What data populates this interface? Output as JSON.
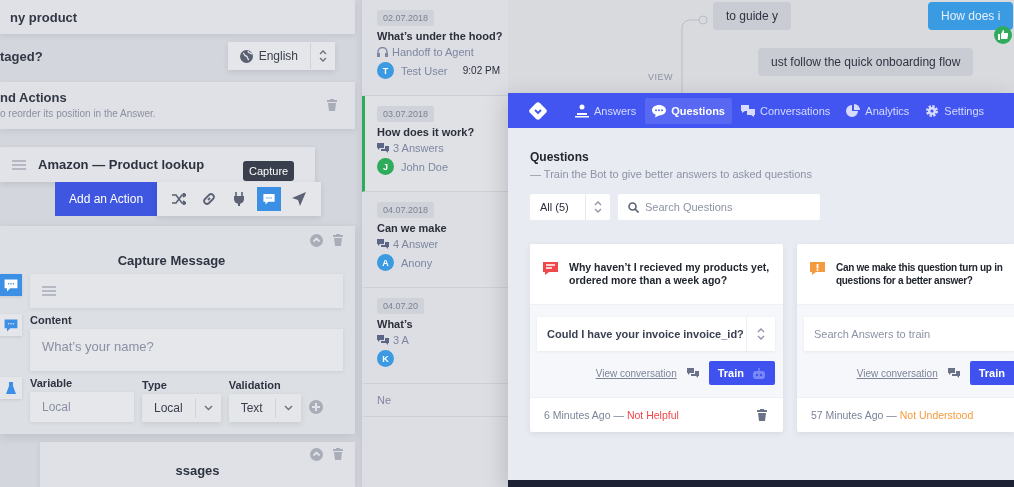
{
  "editor": {
    "heading_fragment": "ny product",
    "question_fragment": "taged?",
    "language": {
      "value": "English"
    },
    "actions": {
      "title": "nd Actions",
      "hint": "o reorder its position in the Answer."
    },
    "action": {
      "title": "Amazon — Product lookup"
    },
    "toolbar": {
      "button": "Add an Action",
      "tools": [
        {
          "kind": "shuffle",
          "selected": false
        },
        {
          "kind": "link",
          "selected": false
        },
        {
          "kind": "plug",
          "selected": false
        },
        {
          "kind": "chat",
          "selected": true,
          "tooltip": "Capture"
        },
        {
          "kind": "send",
          "selected": false
        }
      ]
    },
    "capture": {
      "title": "Capture Message",
      "content": {
        "label": "Content",
        "placeholder": "What’s your name?"
      },
      "type": {
        "label": "Type",
        "value": "Local"
      },
      "validation": {
        "label": "Validation",
        "value": "Text"
      },
      "variable": {
        "label": "Variable",
        "placeholder": "Local"
      }
    },
    "next_card": {
      "title_fragment": "ssages"
    }
  },
  "conversations": [
    {
      "kind": "item",
      "date": "02.07.2018",
      "title": "What’s under the hood?",
      "meta": {
        "kind": "handoff",
        "text": "Handoff to Agent"
      },
      "avatar": "T",
      "color": "#3b9ae1",
      "user": "Test User",
      "time": "9:02 PM",
      "selected": false
    },
    {
      "kind": "item",
      "date": "03.07.2018",
      "title": "How does it work?",
      "meta": {
        "kind": "answers",
        "text": "3 Answers"
      },
      "avatar": "J",
      "color": "#2fab5c",
      "user": "John Doe",
      "selected": true
    },
    {
      "kind": "item",
      "date": "04.07.2018",
      "title": "Can we make",
      "meta": {
        "kind": "answers",
        "text": "4 Answer"
      },
      "avatar": "A",
      "color": "#3b9ae1",
      "user": "Anony",
      "selected": false
    },
    {
      "kind": "item",
      "date": "04.07.20",
      "title": "What’s",
      "meta": {
        "kind": "answers",
        "text": "3 A"
      },
      "avatar": "K",
      "color": "#3b9ae1",
      "selected": false
    },
    {
      "kind": "fragment",
      "title": "Ne",
      "selected": false
    }
  ],
  "chat": {
    "messages": [
      {
        "kind": "bot",
        "text": "to guide y"
      },
      {
        "kind": "user",
        "text": "How does i",
        "liked": true
      },
      {
        "kind": "bot",
        "text": "ust follow the quick onboarding flow"
      }
    ],
    "view_label": "VIEW"
  },
  "app": {
    "tabs": [
      {
        "kind": "answers",
        "label": "Answers",
        "selected": false
      },
      {
        "kind": "questions",
        "label": "Questions",
        "selected": true
      },
      {
        "kind": "conversations",
        "label": "Conversations",
        "selected": false
      },
      {
        "kind": "analytics",
        "label": "Analytics",
        "selected": false
      },
      {
        "kind": "settings",
        "label": "Settings",
        "selected": false
      }
    ],
    "title": "Questions",
    "subtitle": "— Train the Bot to give better answers to asked questions",
    "filter": {
      "value": "All (5)"
    },
    "search": {
      "placeholder": "Search Questions"
    },
    "cards": [
      {
        "kind": "message",
        "color": "#f0474a",
        "question": "Why haven’t I recieved my products yet, ordered more than a week ago?",
        "answer": {
          "value": "Could I have your invoice invoice_id?"
        },
        "link": "View conversation",
        "button": {
          "kind": "icon",
          "label": "Train"
        },
        "time": "6 Minutes Ago —",
        "status": "Not Helpful",
        "deletable": true
      },
      {
        "kind": "alert",
        "color": "#f59b3f",
        "question": "Can we make this question turn up in questions for a better answer?",
        "answer": {
          "placeholder": "Search Answers to train"
        },
        "link": "View conversation",
        "button": {
          "kind": "plain",
          "label": "Train"
        },
        "time": "57 Minutes Ago —",
        "status": "Not Understood"
      }
    ]
  }
}
